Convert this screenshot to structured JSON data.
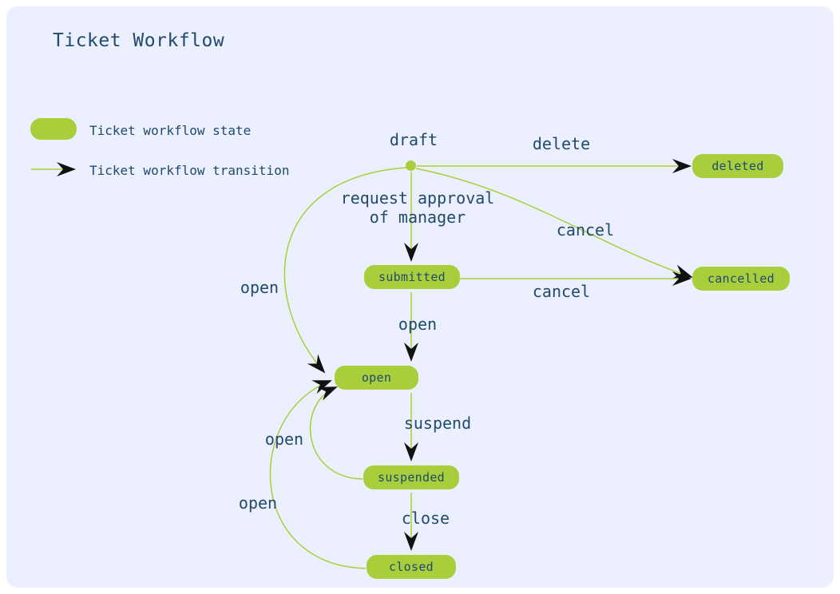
{
  "title": "Ticket Workflow",
  "legend": {
    "state_label": "Ticket workflow state",
    "transition_label": "Ticket workflow transition"
  },
  "start": {
    "label": "draft"
  },
  "nodes": {
    "submitted": {
      "label": "submitted"
    },
    "open": {
      "label": "open"
    },
    "suspended": {
      "label": "suspended"
    },
    "closed": {
      "label": "closed"
    },
    "deleted": {
      "label": "deleted"
    },
    "cancelled": {
      "label": "cancelled"
    }
  },
  "transitions": {
    "draft_to_deleted": {
      "label": "delete"
    },
    "draft_to_submitted": {
      "label": "request approval\nof manager"
    },
    "draft_to_cancelled": {
      "label": "cancel"
    },
    "draft_to_open": {
      "label": "open"
    },
    "submitted_to_cancelled": {
      "label": "cancel"
    },
    "submitted_to_open": {
      "label": "open"
    },
    "open_to_suspended": {
      "label": "suspend"
    },
    "suspended_to_open": {
      "label": "open"
    },
    "suspended_to_closed": {
      "label": "close"
    },
    "closed_to_open": {
      "label": "open"
    }
  }
}
